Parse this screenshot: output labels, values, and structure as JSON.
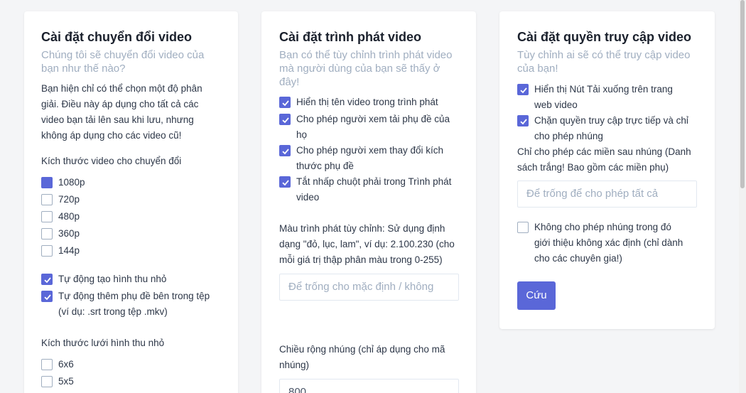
{
  "card1": {
    "title": "Cài đặt chuyển đổi video",
    "subtitle_l1": "Chúng tôi sẽ chuyển đổi video của",
    "subtitle_l2": "bạn như thế nào?",
    "desc_l1": "Bạn hiện chỉ có thể chọn một độ phân",
    "desc_l2": "giải. Điều này áp dụng cho tất cả các",
    "desc_l3": "video bạn tải lên sau khi lưu, nhưng",
    "desc_l4": "không áp dụng cho các video cũ!",
    "size_label": "Kích thước video cho chuyển đổi",
    "resolutions": [
      {
        "label": "1080p",
        "checked": true
      },
      {
        "label": "720p",
        "checked": false
      },
      {
        "label": "480p",
        "checked": false
      },
      {
        "label": "360p",
        "checked": false
      },
      {
        "label": "144p",
        "checked": false
      }
    ],
    "auto_thumb": "Tự động tạo hình thu nhỏ",
    "auto_subs_l1": "Tự động thêm phụ đề bên trong tệp",
    "auto_subs_l2": "(ví dụ: .srt trong tệp .mkv)",
    "grid_label": "Kích thước lưới hình thu nhỏ",
    "grid_options": [
      {
        "label": "6x6",
        "checked": false
      },
      {
        "label": "5x5",
        "checked": false
      }
    ]
  },
  "card2": {
    "title": "Cài đặt trình phát video",
    "subtitle_l1": "Bạn có thể tùy chỉnh trình phát video",
    "subtitle_l2": "mà người dùng của bạn sẽ thấy ở",
    "subtitle_l3": "đây!",
    "opt_title": "Hiển thị tên video trong trình phát",
    "opt_sub_l1": "Cho phép người xem tải phụ đề của",
    "opt_sub_l2": "họ",
    "opt_size_l1": "Cho phép người xem thay đổi kích",
    "opt_size_l2": "thước phụ đề",
    "opt_rc_l1": "Tắt nhấp chuột phải trong Trình phát",
    "opt_rc_l2": "video",
    "color_l1": "Màu trình phát tùy chỉnh: Sử dụng định",
    "color_l2": "dạng \"đỏ, lục, lam\", ví dụ: 2.100.230 (cho",
    "color_l3": "mỗi giá trị thập phân màu trong 0-255)",
    "color_placeholder": "Để trống cho mặc định / không",
    "embed_l1": "Chiều rộng nhúng (chỉ áp dụng cho mã",
    "embed_l2": "nhúng)",
    "embed_value": "800"
  },
  "card3": {
    "title": "Cài đặt quyền truy cập video",
    "subtitle_l1": "Tùy chỉnh ai sẽ có thể truy cập video",
    "subtitle_l2": "của bạn!",
    "opt_dl_l1": "Hiển thị Nút Tải xuống trên trang",
    "opt_dl_l2": "web video",
    "opt_block_l1": "Chặn quyền truy cập trực tiếp và chỉ",
    "opt_block_l2": "cho phép nhúng",
    "domains_l1": "Chỉ cho phép các miền sau nhúng (Danh",
    "domains_l2": "sách trắng! Bao gồm các miền phụ)",
    "domains_placeholder": "Để trống để cho phép tất cả",
    "opt_ref_l1": "Không cho phép nhúng trong đó",
    "opt_ref_l2": "giới thiệu không xác định (chỉ dành",
    "opt_ref_l3": "cho các chuyên gia!)",
    "save_label": "Cứu"
  },
  "colors": {
    "accent": "#5a67d8",
    "muted": "#a0aec0",
    "text": "#2d3748"
  }
}
